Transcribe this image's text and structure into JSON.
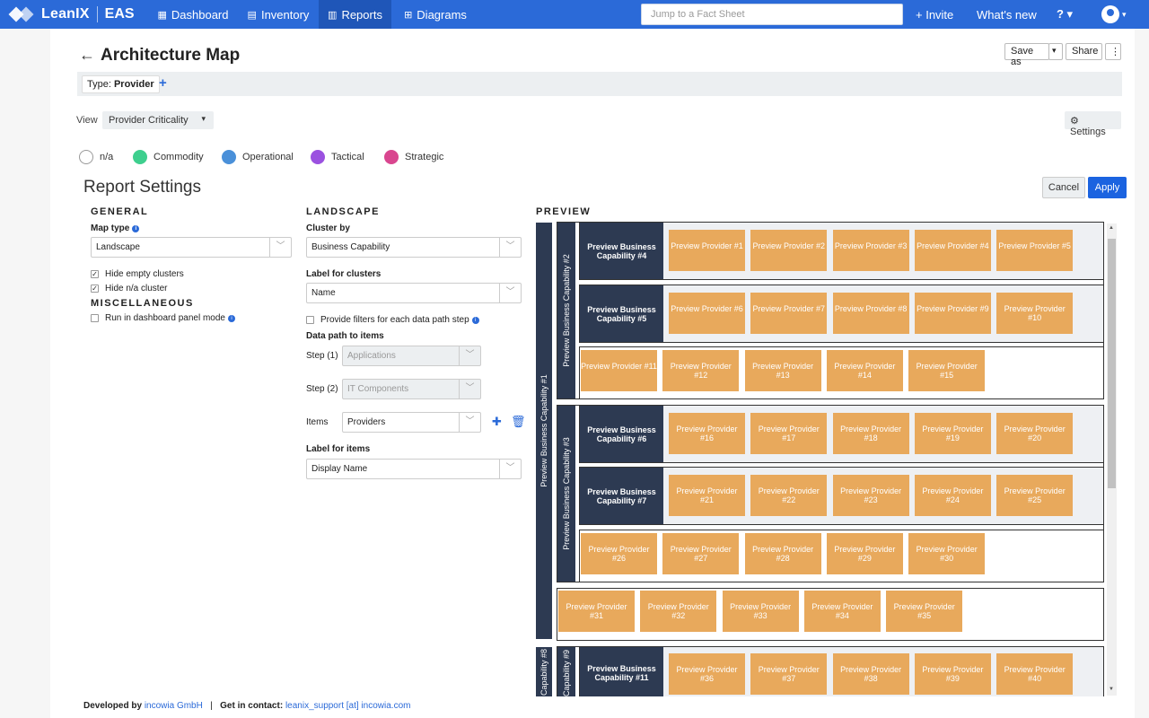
{
  "nav": {
    "brand": "LeanIX",
    "workspace": "EAS",
    "items": [
      {
        "label": "Dashboard",
        "icon": "dashboard-icon"
      },
      {
        "label": "Inventory",
        "icon": "inventory-icon"
      },
      {
        "label": "Reports",
        "icon": "reports-icon"
      },
      {
        "label": "Diagrams",
        "icon": "diagrams-icon"
      }
    ],
    "search_placeholder": "Jump to a Fact Sheet",
    "invite": "+ Invite",
    "whats_new": "What's new",
    "help": "? ▾",
    "user_caret": "▾"
  },
  "header": {
    "title": "Architecture Map",
    "save_as": "Save as",
    "share": "Share",
    "more": "⋮",
    "filter_label": "Type:",
    "filter_value": "Provider",
    "view_label": "View",
    "view_value": "Provider Criticality",
    "settings": "Settings"
  },
  "legend": [
    {
      "label": "n/a",
      "color": "#ffffff"
    },
    {
      "label": "Commodity",
      "color": "#3ecf8e"
    },
    {
      "label": "Operational",
      "color": "#4a90d9"
    },
    {
      "label": "Tactical",
      "color": "#9b51e0"
    },
    {
      "label": "Strategic",
      "color": "#d9468f"
    }
  ],
  "settings": {
    "title": "Report Settings",
    "cancel": "Cancel",
    "apply": "Apply",
    "general": "GENERAL",
    "map_type_label": "Map type",
    "map_type_value": "Landscape",
    "hide_empty": "Hide empty clusters",
    "hide_na": "Hide n/a cluster",
    "misc": "MISCELLANEOUS",
    "dashboard_mode": "Run in dashboard panel mode",
    "landscape": "LANDSCAPE",
    "cluster_by_label": "Cluster by",
    "cluster_by_value": "Business Capability",
    "label_clusters_label": "Label for clusters",
    "label_clusters_value": "Name",
    "provide_filters": "Provide filters for each data path step",
    "data_path": "Data path to items",
    "step1_label": "Step (1)",
    "step1_value": "Applications",
    "step2_label": "Step (2)",
    "step2_value": "IT Components",
    "items_label": "Items",
    "items_value": "Providers",
    "label_items_label": "Label for items",
    "label_items_value": "Display Name"
  },
  "preview": {
    "title": "PREVIEW",
    "cap1": "Preview Business Capability #1",
    "cap2": "Preview Business Capability #2",
    "cap3": "Preview Business Capability #3",
    "cap8": "Capability #8",
    "cap9": "Capability #9",
    "cap4": "Preview Business Capability #4",
    "cap5": "Preview Business Capability #5",
    "cap6": "Preview Business Capability #6",
    "cap7": "Preview Business Capability #7",
    "cap11": "Preview Business Capability #11",
    "providers": [
      "Preview Provider #1",
      "Preview Provider #2",
      "Preview Provider #3",
      "Preview Provider #4",
      "Preview Provider #5",
      "Preview Provider #6",
      "Preview Provider #7",
      "Preview Provider #8",
      "Preview Provider #9",
      "Preview Provider #10",
      "Preview Provider #11",
      "Preview Provider #12",
      "Preview Provider #13",
      "Preview Provider #14",
      "Preview Provider #15",
      "Preview Provider #16",
      "Preview Provider #17",
      "Preview Provider #18",
      "Preview Provider #19",
      "Preview Provider #20",
      "Preview Provider #21",
      "Preview Provider #22",
      "Preview Provider #23",
      "Preview Provider #24",
      "Preview Provider #25",
      "Preview Provider #26",
      "Preview Provider #27",
      "Preview Provider #28",
      "Preview Provider #29",
      "Preview Provider #30",
      "Preview Provider #31",
      "Preview Provider #32",
      "Preview Provider #33",
      "Preview Provider #34",
      "Preview Provider #35",
      "Preview Provider #36",
      "Preview Provider #37",
      "Preview Provider #38",
      "Preview Provider #39",
      "Preview Provider #40"
    ]
  },
  "footer": {
    "dev_prefix": "Developed by",
    "dev_link": "incowia GmbH",
    "sep": "|",
    "contact_prefix": "Get in contact:",
    "contact_link": "leanix_support [at] incowia.com"
  }
}
